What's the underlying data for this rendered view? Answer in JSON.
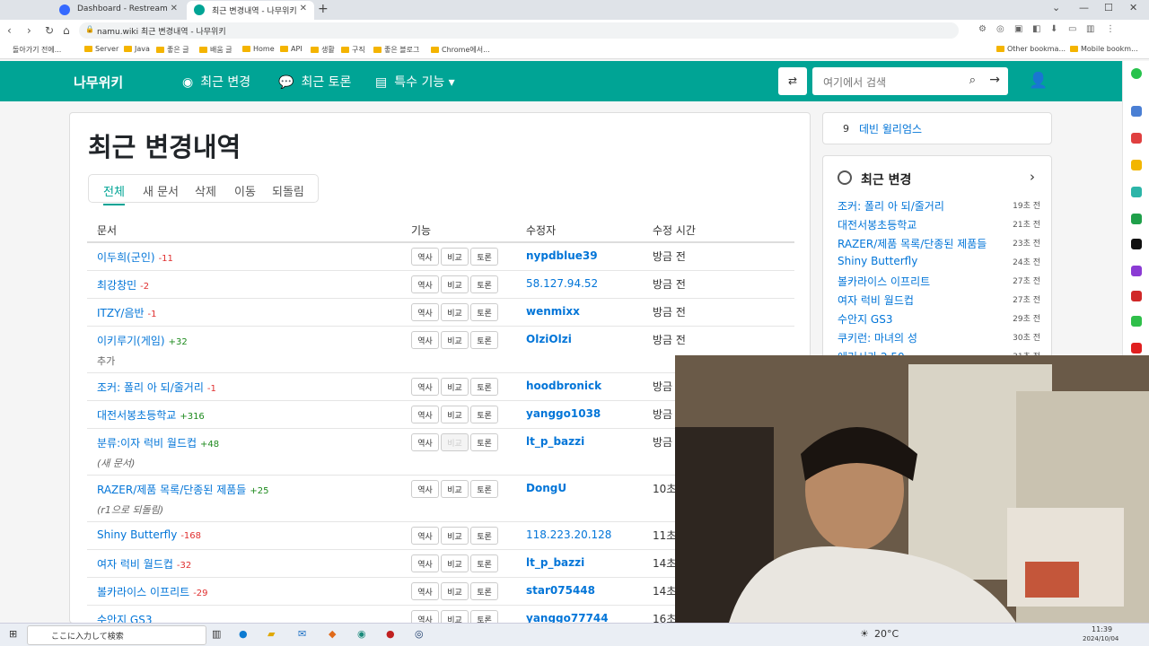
{
  "browser": {
    "tabs": [
      {
        "title": "Dashboard - Restream",
        "active": false,
        "favicon_color": "#3569ff"
      },
      {
        "title": "최근 변경내역 - 나무위키",
        "active": true,
        "favicon_color": "#00a495"
      }
    ],
    "url": "namu.wiki 최근 변경내역 - 나무위키",
    "bookmarks": [
      "돌아가기 전에...",
      "Server",
      "Java",
      "좋은 글",
      "배움 글",
      "Home",
      "API",
      "생활",
      "구직",
      "좋은 블로그",
      "Chrome에서...",
      "Other bookma...",
      "Mobile bookm..."
    ]
  },
  "nav": {
    "logo": "나무위키",
    "items": [
      {
        "label": "최근 변경",
        "icon": "compass-icon"
      },
      {
        "label": "최근 토론",
        "icon": "comments-icon"
      },
      {
        "label": "특수 기능",
        "icon": "toolbox-icon"
      }
    ],
    "search_placeholder": "여기에서 검색"
  },
  "page": {
    "title": "최근 변경내역",
    "filters": [
      "전체",
      "새 문서",
      "삭제",
      "이동",
      "되돌림"
    ],
    "active_filter": "전체",
    "columns": [
      "문서",
      "기능",
      "수정자",
      "수정 시간"
    ],
    "action_labels": {
      "history": "역사",
      "compare": "비교",
      "discuss": "토론"
    },
    "rows": [
      {
        "doc": "이두희(군인)",
        "delta": "-11",
        "note": "",
        "author": "nypdblue39",
        "time": "방금 전"
      },
      {
        "doc": "최강창민",
        "delta": "-2",
        "note": "",
        "author": "58.127.94.52",
        "time": "방금 전"
      },
      {
        "doc": "ITZY/음반",
        "delta": "-1",
        "note": "",
        "author": "wenmixx",
        "time": "방금 전"
      },
      {
        "doc": "이키루기(게임)",
        "delta": "+32",
        "note": "추가",
        "author": "OlziOlzi",
        "time": "방금 전"
      },
      {
        "doc": "조커: 폴리 아 되/줄거리",
        "delta": "-1",
        "note": "",
        "author": "hoodbronick",
        "time": "방금"
      },
      {
        "doc": "대전서봉초등학교",
        "delta": "+316",
        "note": "",
        "author": "yanggo1038",
        "time": "방금"
      },
      {
        "doc": "분류:이자 럭비 월드컵",
        "delta": "+48",
        "note": "(새 문서)",
        "author": "lt_p_bazzi",
        "time": "방금"
      },
      {
        "doc": "RAZER/제품 목록/단종된 제품들",
        "delta": "+25",
        "note": "(r1으로 되돌림)",
        "author": "DongU",
        "time": "10초"
      },
      {
        "doc": "Shiny Butterfly",
        "delta": "-168",
        "note": "",
        "author": "118.223.20.128",
        "time": "11초"
      },
      {
        "doc": "여자 럭비 월드컵",
        "delta": "-32",
        "note": "",
        "author": "lt_p_bazzi",
        "time": "14초"
      },
      {
        "doc": "볼카라이스 이프리트",
        "delta": "-29",
        "note": "",
        "author": "star075448",
        "time": "14초"
      },
      {
        "doc": "수안지 GS3",
        "delta": "",
        "note": "",
        "author": "yanggo77744",
        "time": "16초"
      }
    ]
  },
  "sidebar": {
    "wb_num": "9",
    "wb_title": "데빈 윌리엄스",
    "recent_title": "최근 변경",
    "recent_items": [
      {
        "name": "조커: 폴리 아 되/줄거리",
        "time": "19초 전"
      },
      {
        "name": "대전서봉초등학교",
        "time": "21초 전"
      },
      {
        "name": "RAZER/제품 목록/단종된 제품들",
        "time": "23초 전"
      },
      {
        "name": "Shiny Butterfly",
        "time": "24초 전"
      },
      {
        "name": "볼카라이스 이프리트",
        "time": "27초 전"
      },
      {
        "name": "여자 럭비 월드컵",
        "time": "27초 전"
      },
      {
        "name": "수안지 GS3",
        "time": "29초 전"
      },
      {
        "name": "쿠키런: 마녀의 성",
        "time": "30초 전"
      },
      {
        "name": "에리시카 2.50",
        "time": "31초 전"
      }
    ]
  },
  "taskbar": {
    "search": "ここに入力して検索",
    "weather": "20°C",
    "time": "11:39",
    "date": "2024/10/04"
  },
  "colors": {
    "brand": "#00a495",
    "link": "#0275d8"
  }
}
